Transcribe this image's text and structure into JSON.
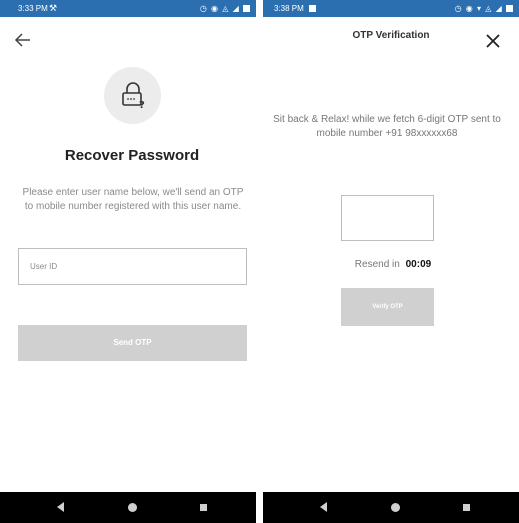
{
  "left_screen": {
    "status_bar": {
      "time": "3:33 PM"
    },
    "title": "Recover Password",
    "description": "Please enter user name below, we'll send an OTP to mobile number registered with this user name.",
    "user_id_placeholder": "User ID",
    "send_otp_label": "Send OTP"
  },
  "right_screen": {
    "status_bar": {
      "time": "3:38 PM"
    },
    "header_title": "OTP Verification",
    "message": "Sit back & Relax! while we fetch 6-digit OTP sent to mobile number +91 98xxxxxx68",
    "resend_label": "Resend in",
    "resend_timer": "00:09",
    "verify_label": "Verify OTP"
  },
  "colors": {
    "status_bar": "#2c6fb0",
    "disabled_button": "#d0d0d0",
    "nav_bar": "#000000"
  },
  "icons": {
    "back": "arrow-left-icon",
    "lock": "lock-question-icon",
    "close": "close-icon"
  }
}
